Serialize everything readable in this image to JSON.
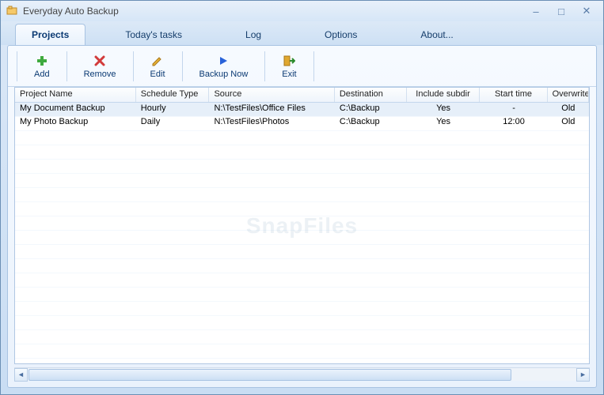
{
  "window": {
    "title": "Everyday Auto Backup"
  },
  "tabs": [
    {
      "label": "Projects",
      "active": true
    },
    {
      "label": "Today's tasks",
      "active": false
    },
    {
      "label": "Log",
      "active": false
    },
    {
      "label": "Options",
      "active": false
    },
    {
      "label": "About...",
      "active": false
    }
  ],
  "toolbar": {
    "add": "Add",
    "remove": "Remove",
    "edit": "Edit",
    "backup_now": "Backup Now",
    "exit": "Exit"
  },
  "table": {
    "columns": [
      "Project Name",
      "Schedule Type",
      "Source",
      "Destination",
      "Include subdir",
      "Start time",
      "Overwrite"
    ],
    "rows": [
      {
        "name": "My Document Backup",
        "schedule": "Hourly",
        "source": "N:\\TestFiles\\Office Files",
        "dest": "C:\\Backup",
        "subdir": "Yes",
        "start": "-",
        "overwrite": "Old",
        "selected": true
      },
      {
        "name": "My Photo Backup",
        "schedule": "Daily",
        "source": "N:\\TestFiles\\Photos",
        "dest": "C:\\Backup",
        "subdir": "Yes",
        "start": "12:00",
        "overwrite": "Old",
        "selected": false
      }
    ]
  },
  "watermark": "SnapFiles"
}
